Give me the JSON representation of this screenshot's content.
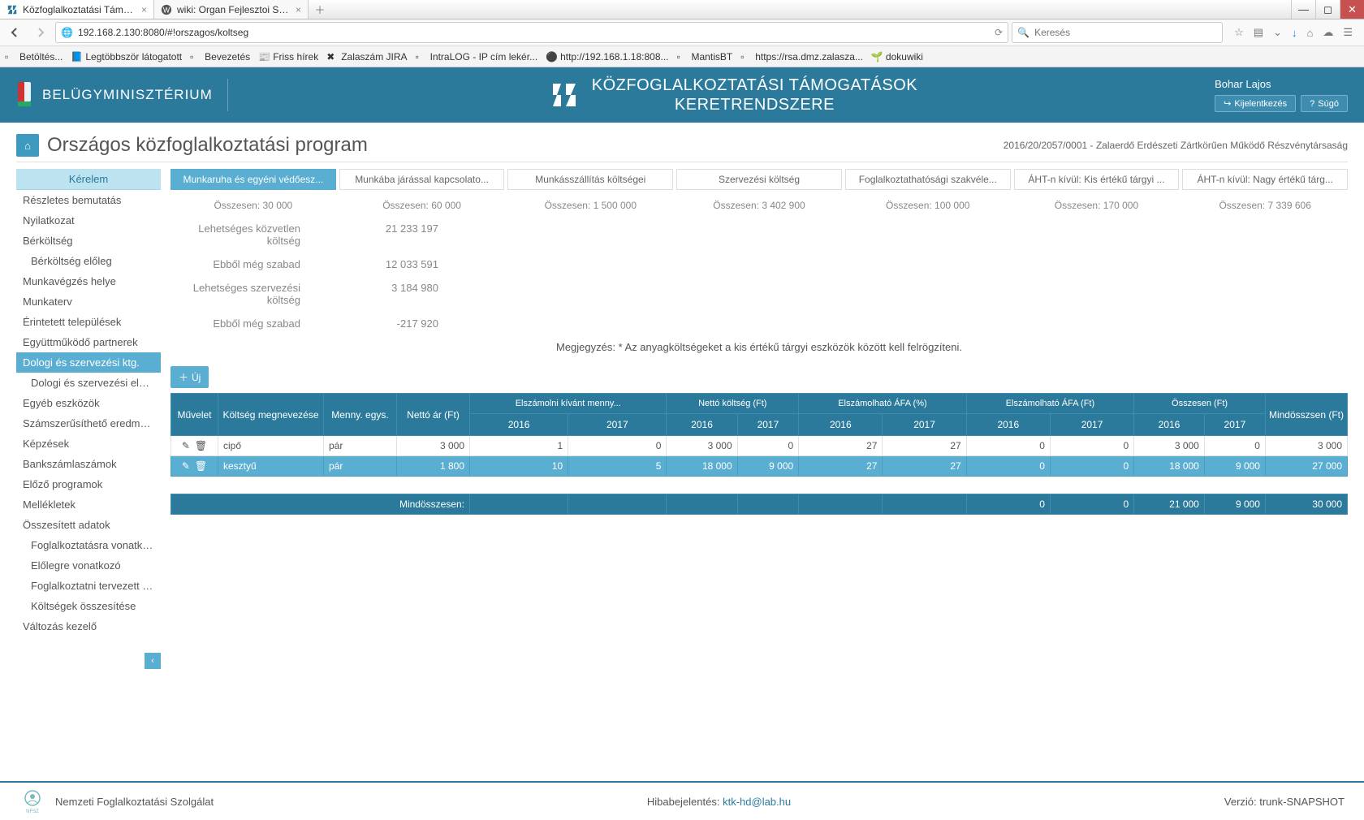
{
  "window": {
    "tab1": "Közfoglalkoztatási Támog...",
    "tab2": "wiki: Organ Fejlesztoi Szer..."
  },
  "nav": {
    "url": "192.168.2.130:8080/#!orszagos/koltseg",
    "search_placeholder": "Keresés"
  },
  "bookmarks": [
    "Betöltés...",
    "Legtöbbször látogatott",
    "Bevezetés",
    "Friss hírek",
    "Zalaszám JIRA",
    "IntraLOG - IP cím lekér...",
    "http://192.168.1.18:808...",
    "MantisBT",
    "https://rsa.dmz.zalasza...",
    "dokuwiki"
  ],
  "header": {
    "ministry": "BELÜGYMINISZTÉRIUM",
    "app_title_1": "KÖZFOGLALKOZTATÁSI TÁMOGATÁSOK",
    "app_title_2": "KERETRENDSZERE",
    "user": "Bohar Lajos",
    "logout": "Kijelentkezés",
    "help": "Súgó"
  },
  "page": {
    "title": "Országos közfoglalkoztatási program",
    "breadcrumb": "2016/20/2057/0001 - Zalaerdő Erdészeti Zártkörűen Működő Részvénytársaság"
  },
  "sidebar": {
    "header": "Kérelem",
    "items": [
      "Részletes bemutatás",
      "Nyilatkozat",
      "Bérköltség",
      "Bérköltség előleg",
      "Munkavégzés helye",
      "Munkaterv",
      "Érintetett települések",
      "Együttműködő partnerek",
      "Dologi és szervezési ktg.",
      "Dologi és szervezési előleg",
      "Egyéb eszközök",
      "Számszerűsíthető eredmény...",
      "Képzések",
      "Bankszámlaszámok",
      "Előző programok",
      "Mellékletek",
      "Összesített adatok",
      "Foglalkoztatásra vonatkozó",
      "Előlegre vonatkozó",
      "Foglalkoztatni tervezett lét...",
      "Költségek összesítése",
      "Változás kezelő"
    ]
  },
  "tabs": [
    {
      "label": "Munkaruha és egyéni védőesz...",
      "sum": "Összesen: 30 000"
    },
    {
      "label": "Munkába járással kapcsolato...",
      "sum": "Összesen: 60 000"
    },
    {
      "label": "Munkásszállítás költségei",
      "sum": "Összesen: 1 500 000"
    },
    {
      "label": "Szervezési költség",
      "sum": "Összesen: 3 402 900"
    },
    {
      "label": "Foglalkoztathatósági szakvéle...",
      "sum": "Összesen: 100 000"
    },
    {
      "label": "ÁHT-n kívül: Kis értékű tárgyi ...",
      "sum": "Összesen: 170 000"
    },
    {
      "label": "ÁHT-n kívül: Nagy értékű tárg...",
      "sum": "Összesen: 7 339 606"
    }
  ],
  "stats": [
    {
      "label": "Lehetséges közvetlen költség",
      "value": "21 233 197"
    },
    {
      "label": "Ebből még szabad",
      "value": "12 033 591"
    },
    {
      "label": "Lehetséges szervezési költség",
      "value": "3 184 980"
    },
    {
      "label": "Ebből még szabad",
      "value": "-217 920"
    }
  ],
  "note": "Megjegyzés: * Az anyagköltségeket a kis értékű tárgyi eszközök között kell felrögzíteni.",
  "btn_new": "Új",
  "tbl": {
    "h_op": "Művelet",
    "h_name": "Költség megnevezése",
    "h_unit": "Menny. egys.",
    "h_price": "Nettó ár (Ft)",
    "g_qty": "Elszámolni kívánt menny...",
    "g_net": "Nettó költség (Ft)",
    "g_vatpct": "Elszámolható ÁFA (%)",
    "g_vat": "Elszámolható ÁFA (Ft)",
    "g_total": "Összesen (Ft)",
    "y1": "2016",
    "y2": "2017",
    "h_grand": "Mindösszsen (Ft)",
    "rows": [
      {
        "name": "cipő",
        "unit": "pár",
        "price": "3 000",
        "q1": "1",
        "q2": "0",
        "n1": "3 000",
        "n2": "0",
        "vp1": "27",
        "vp2": "27",
        "v1": "0",
        "v2": "0",
        "t1": "3 000",
        "t2": "0",
        "g": "3 000"
      },
      {
        "name": "kesztyű",
        "unit": "pár",
        "price": "1 800",
        "q1": "10",
        "q2": "5",
        "n1": "18 000",
        "n2": "9 000",
        "vp1": "27",
        "vp2": "27",
        "v1": "0",
        "v2": "0",
        "t1": "18 000",
        "t2": "9 000",
        "g": "27 000"
      }
    ],
    "total_label": "Mindösszesen:",
    "tot_v1": "0",
    "tot_v2": "0",
    "tot_t1": "21 000",
    "tot_t2": "9 000",
    "tot_g": "30 000"
  },
  "footer": {
    "org": "Nemzeti Foglalkoztatási Szolgálat",
    "bug_prefix": "Hibabejelentés: ",
    "bug_email": "ktk-hd@lab.hu",
    "version": "Verzió: trunk-SNAPSHOT"
  }
}
